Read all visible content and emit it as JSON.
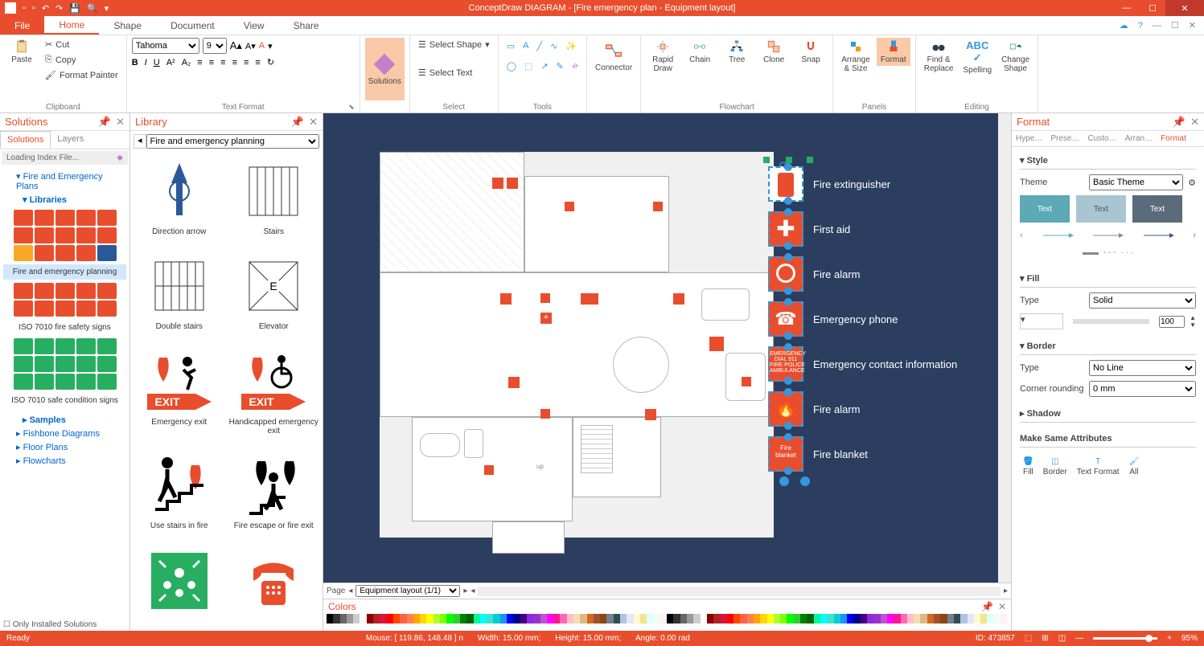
{
  "titlebar": {
    "app_title": "ConceptDraw DIAGRAM - [Fire emergency plan - Equipment layout]"
  },
  "tabs": {
    "file": "File",
    "items": [
      "Home",
      "Shape",
      "Document",
      "View",
      "Share"
    ],
    "active_index": 0
  },
  "ribbon": {
    "clipboard": {
      "label": "Clipboard",
      "paste": "Paste",
      "cut": "Cut",
      "copy": "Copy",
      "format_painter": "Format Painter"
    },
    "text_format": {
      "label": "Text Format",
      "font": "Tahoma",
      "size": "9"
    },
    "solutions": {
      "label": "Solutions"
    },
    "select": {
      "label": "Select",
      "select_shape": "Select Shape",
      "select_text": "Select Text"
    },
    "tools": {
      "label": "Tools",
      "connector": "Connector"
    },
    "flowchart": {
      "label": "Flowchart",
      "rapid_draw": "Rapid\nDraw",
      "chain": "Chain",
      "tree": "Tree",
      "clone": "Clone",
      "snap": "Snap"
    },
    "panels": {
      "label": "Panels",
      "arrange_size": "Arrange\n& Size",
      "format": "Format"
    },
    "editing": {
      "label": "Editing",
      "find_replace": "Find &\nReplace",
      "spelling": "Spelling",
      "change_shape": "Change\nShape"
    }
  },
  "solutions_panel": {
    "title": "Solutions",
    "tabs": [
      "Solutions",
      "Layers"
    ],
    "loading": "Loading Index File...",
    "tree": {
      "nodes": [
        {
          "label": "Fire and Emergency Plans",
          "type": "collapse"
        },
        {
          "label": "Libraries",
          "type": "collapse",
          "bold": true
        }
      ]
    },
    "categories": [
      {
        "label": "Fire and emergency planning",
        "active": true
      },
      {
        "label": "ISO 7010 fire safety signs",
        "active": false
      },
      {
        "label": "ISO 7010 safe condition signs",
        "active": false
      }
    ],
    "samples": "Samples",
    "extras": [
      "Fishbone Diagrams",
      "Floor Plans",
      "Flowcharts"
    ],
    "only_installed": "Only Installed Solutions"
  },
  "library_panel": {
    "title": "Library",
    "dropdown": "Fire and emergency planning",
    "items": [
      "Direction arrow",
      "Stairs",
      "Double stairs",
      "Elevator",
      "Emergency exit",
      "Handicapped emergency exit",
      "Use stairs in fire",
      "Fire escape or fire exit"
    ]
  },
  "canvas": {
    "page_label": "Page",
    "page_dropdown": "Equipment layout (1/1)",
    "colors_title": "Colors",
    "legend": [
      "Fire extinguisher",
      "First aid",
      "Fire alarm",
      "Emergency phone",
      "Emergency contact information",
      "Fire alarm",
      "Fire blanket"
    ]
  },
  "format_panel": {
    "title": "Format",
    "tabs": [
      "Hype…",
      "Prese…",
      "Custo…",
      "Arran…",
      "Format"
    ],
    "active_tab": 4,
    "style": {
      "header": "Style",
      "theme_label": "Theme",
      "theme_value": "Basic Theme",
      "theme_boxes": [
        "Text",
        "Text",
        "Text"
      ]
    },
    "fill": {
      "header": "Fill",
      "type_label": "Type",
      "type_value": "Solid",
      "opacity": "100"
    },
    "border": {
      "header": "Border",
      "type_label": "Type",
      "type_value": "No Line",
      "corner_label": "Corner rounding",
      "corner_value": "0 mm"
    },
    "shadow": {
      "header": "Shadow"
    },
    "same_attr": {
      "header": "Make Same Attributes",
      "buttons": [
        "Fill",
        "Border",
        "Text Format",
        "All"
      ]
    }
  },
  "statusbar": {
    "ready": "Ready",
    "mouse": "Mouse: [ 119.86, 148.48 ] n",
    "width": "Width: 15.00 mm;",
    "height": "Height: 15.00 mm;",
    "angle": "Angle: 0.00 rad",
    "id": "ID: 473857",
    "zoom": "95%"
  },
  "color_palette": [
    "#000",
    "#333",
    "#666",
    "#999",
    "#ccc",
    "#fff",
    "#8b0000",
    "#b22222",
    "#dc143c",
    "#ff0000",
    "#ff4500",
    "#ff6347",
    "#ff7f50",
    "#ffa500",
    "#ffd700",
    "#ffff00",
    "#adff2f",
    "#7fff00",
    "#00ff00",
    "#32cd32",
    "#008000",
    "#006400",
    "#00fa9a",
    "#00ffff",
    "#40e0d0",
    "#00ced1",
    "#1e90ff",
    "#0000ff",
    "#00008b",
    "#4b0082",
    "#8a2be2",
    "#9932cc",
    "#ba55d3",
    "#ff00ff",
    "#ff1493",
    "#ff69b4",
    "#ffc0cb",
    "#f5deb3",
    "#deb887",
    "#d2691e",
    "#a0522d",
    "#8b4513",
    "#708090",
    "#2f4f4f",
    "#b0c4de",
    "#e6e6fa",
    "#fffacd",
    "#f0e68c",
    "#e0ffff",
    "#f0fff0",
    "#fff0f5"
  ]
}
